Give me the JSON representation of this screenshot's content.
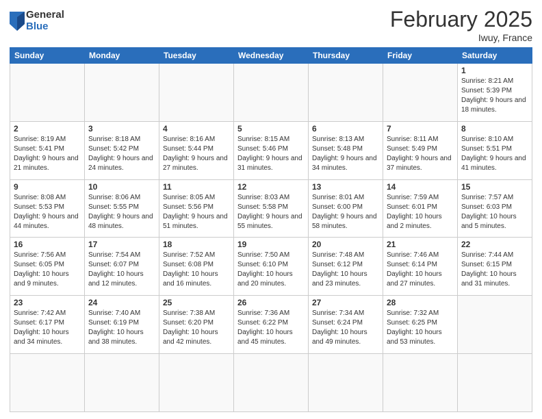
{
  "logo": {
    "general": "General",
    "blue": "Blue"
  },
  "header": {
    "month_year": "February 2025",
    "location": "Iwuy, France"
  },
  "weekdays": [
    "Sunday",
    "Monday",
    "Tuesday",
    "Wednesday",
    "Thursday",
    "Friday",
    "Saturday"
  ],
  "days": [
    {
      "date": null,
      "info": null
    },
    {
      "date": null,
      "info": null
    },
    {
      "date": null,
      "info": null
    },
    {
      "date": null,
      "info": null
    },
    {
      "date": null,
      "info": null
    },
    {
      "date": null,
      "info": null
    },
    {
      "date": "1",
      "info": "Sunrise: 8:21 AM\nSunset: 5:39 PM\nDaylight: 9 hours and 18 minutes."
    },
    {
      "date": "2",
      "info": "Sunrise: 8:19 AM\nSunset: 5:41 PM\nDaylight: 9 hours and 21 minutes."
    },
    {
      "date": "3",
      "info": "Sunrise: 8:18 AM\nSunset: 5:42 PM\nDaylight: 9 hours and 24 minutes."
    },
    {
      "date": "4",
      "info": "Sunrise: 8:16 AM\nSunset: 5:44 PM\nDaylight: 9 hours and 27 minutes."
    },
    {
      "date": "5",
      "info": "Sunrise: 8:15 AM\nSunset: 5:46 PM\nDaylight: 9 hours and 31 minutes."
    },
    {
      "date": "6",
      "info": "Sunrise: 8:13 AM\nSunset: 5:48 PM\nDaylight: 9 hours and 34 minutes."
    },
    {
      "date": "7",
      "info": "Sunrise: 8:11 AM\nSunset: 5:49 PM\nDaylight: 9 hours and 37 minutes."
    },
    {
      "date": "8",
      "info": "Sunrise: 8:10 AM\nSunset: 5:51 PM\nDaylight: 9 hours and 41 minutes."
    },
    {
      "date": "9",
      "info": "Sunrise: 8:08 AM\nSunset: 5:53 PM\nDaylight: 9 hours and 44 minutes."
    },
    {
      "date": "10",
      "info": "Sunrise: 8:06 AM\nSunset: 5:55 PM\nDaylight: 9 hours and 48 minutes."
    },
    {
      "date": "11",
      "info": "Sunrise: 8:05 AM\nSunset: 5:56 PM\nDaylight: 9 hours and 51 minutes."
    },
    {
      "date": "12",
      "info": "Sunrise: 8:03 AM\nSunset: 5:58 PM\nDaylight: 9 hours and 55 minutes."
    },
    {
      "date": "13",
      "info": "Sunrise: 8:01 AM\nSunset: 6:00 PM\nDaylight: 9 hours and 58 minutes."
    },
    {
      "date": "14",
      "info": "Sunrise: 7:59 AM\nSunset: 6:01 PM\nDaylight: 10 hours and 2 minutes."
    },
    {
      "date": "15",
      "info": "Sunrise: 7:57 AM\nSunset: 6:03 PM\nDaylight: 10 hours and 5 minutes."
    },
    {
      "date": "16",
      "info": "Sunrise: 7:56 AM\nSunset: 6:05 PM\nDaylight: 10 hours and 9 minutes."
    },
    {
      "date": "17",
      "info": "Sunrise: 7:54 AM\nSunset: 6:07 PM\nDaylight: 10 hours and 12 minutes."
    },
    {
      "date": "18",
      "info": "Sunrise: 7:52 AM\nSunset: 6:08 PM\nDaylight: 10 hours and 16 minutes."
    },
    {
      "date": "19",
      "info": "Sunrise: 7:50 AM\nSunset: 6:10 PM\nDaylight: 10 hours and 20 minutes."
    },
    {
      "date": "20",
      "info": "Sunrise: 7:48 AM\nSunset: 6:12 PM\nDaylight: 10 hours and 23 minutes."
    },
    {
      "date": "21",
      "info": "Sunrise: 7:46 AM\nSunset: 6:14 PM\nDaylight: 10 hours and 27 minutes."
    },
    {
      "date": "22",
      "info": "Sunrise: 7:44 AM\nSunset: 6:15 PM\nDaylight: 10 hours and 31 minutes."
    },
    {
      "date": "23",
      "info": "Sunrise: 7:42 AM\nSunset: 6:17 PM\nDaylight: 10 hours and 34 minutes."
    },
    {
      "date": "24",
      "info": "Sunrise: 7:40 AM\nSunset: 6:19 PM\nDaylight: 10 hours and 38 minutes."
    },
    {
      "date": "25",
      "info": "Sunrise: 7:38 AM\nSunset: 6:20 PM\nDaylight: 10 hours and 42 minutes."
    },
    {
      "date": "26",
      "info": "Sunrise: 7:36 AM\nSunset: 6:22 PM\nDaylight: 10 hours and 45 minutes."
    },
    {
      "date": "27",
      "info": "Sunrise: 7:34 AM\nSunset: 6:24 PM\nDaylight: 10 hours and 49 minutes."
    },
    {
      "date": "28",
      "info": "Sunrise: 7:32 AM\nSunset: 6:25 PM\nDaylight: 10 hours and 53 minutes."
    },
    {
      "date": null,
      "info": null
    },
    {
      "date": null,
      "info": null
    },
    {
      "date": null,
      "info": null
    }
  ]
}
